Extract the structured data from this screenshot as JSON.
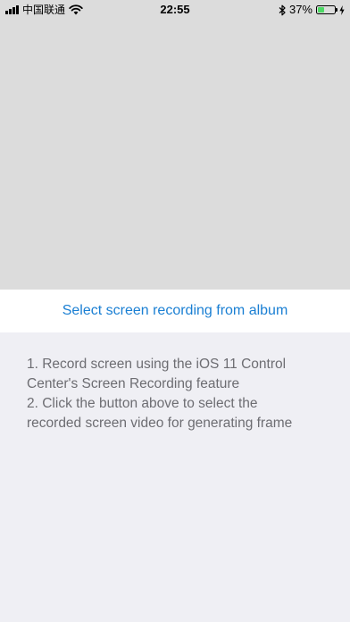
{
  "status_bar": {
    "carrier": "中国联通",
    "time": "22:55",
    "battery_percent": "37%",
    "battery_level": 0.37,
    "icons": [
      "signal-bars-icon",
      "wifi-icon",
      "bluetooth-icon",
      "battery-icon",
      "charging-icon"
    ]
  },
  "preview": {
    "background_color": "#dcdcdc"
  },
  "select_button": {
    "label": "Select screen recording from album",
    "color": "#1a7fd3"
  },
  "instructions": {
    "lines": [
      "1. Record screen using the iOS 11 Control",
      "Center's Screen Recording feature",
      "2. Click the button above to select the",
      "recorded screen video for generating frame"
    ]
  }
}
